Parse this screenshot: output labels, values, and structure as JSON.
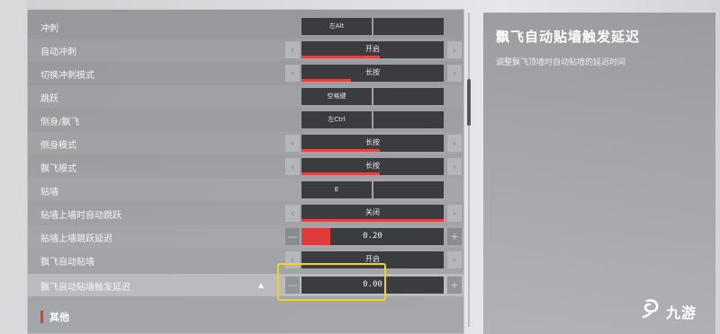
{
  "settings": {
    "rows": [
      {
        "label": "冲刺",
        "type": "key",
        "primary": "左Alt",
        "secondary": ""
      },
      {
        "label": "自动冲刺",
        "type": "select",
        "value": "开启",
        "bar": 0.55
      },
      {
        "label": "切换冲刺模式",
        "type": "select",
        "value": "长按",
        "bar": 0.35
      },
      {
        "label": "跳跃",
        "type": "key",
        "primary": "空格键",
        "secondary": ""
      },
      {
        "label": "侧身/飘飞",
        "type": "key",
        "primary": "左Ctrl",
        "secondary": ""
      },
      {
        "label": "侧身模式",
        "type": "select",
        "value": "长按",
        "bar": 0.55
      },
      {
        "label": "飘飞模式",
        "type": "select",
        "value": "长按",
        "bar": 0.55
      },
      {
        "label": "贴墙",
        "type": "key",
        "primary": "E",
        "secondary": ""
      },
      {
        "label": "贴墙上墙时自动跳跃",
        "type": "select",
        "value": "关闭",
        "bar": 1.0
      },
      {
        "label": "贴墙上墙跳跃延迟",
        "type": "slider",
        "value": "0.20",
        "fill": 0.2
      },
      {
        "label": "飘飞自动贴墙",
        "type": "select",
        "value": "开启",
        "bar": 0.0
      },
      {
        "label": "飘飞自动贴墙触发延迟",
        "type": "slider",
        "value": "0.00",
        "fill": 0.0
      }
    ],
    "section_other": "其他",
    "arrow_left": "‹",
    "arrow_right": "›",
    "minus": "—",
    "plus": "+"
  },
  "detail": {
    "title": "飘飞自动贴墙触发延迟",
    "description": "调整飘飞顶墙时自动贴墙的延迟时间"
  },
  "watermark": {
    "text": "九游",
    "icon": "jiuyou-logo-icon"
  },
  "colors": {
    "accent": "#e03a3a",
    "highlight": "#f2d41e",
    "control_bg": "#3b3c40"
  }
}
